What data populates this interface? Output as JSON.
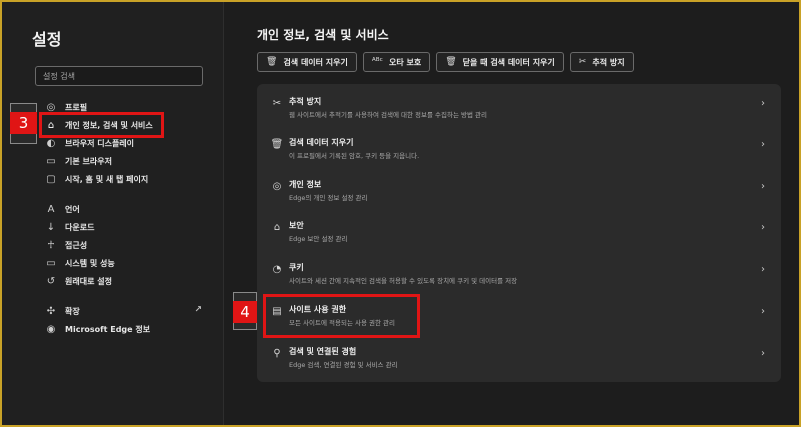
{
  "sidebar": {
    "title": "설정",
    "search_placeholder": "설정 검색",
    "items": [
      {
        "label": "프로필",
        "icon": "profile-icon"
      },
      {
        "label": "개인 정보, 검색 및 서비스",
        "icon": "lock-icon"
      },
      {
        "label": "브라우저 디스플레이",
        "icon": "palette-icon"
      },
      {
        "label": "기본 브라우저",
        "icon": "browser-icon"
      },
      {
        "label": "시작, 홈 및 새 탭 페이지",
        "icon": "home-icon"
      },
      {
        "label": "언어",
        "icon": "language-icon"
      },
      {
        "label": "다운로드",
        "icon": "download-icon"
      },
      {
        "label": "접근성",
        "icon": "accessibility-icon"
      },
      {
        "label": "시스템 및 성능",
        "icon": "system-icon"
      },
      {
        "label": "원래대로 설정",
        "icon": "reset-icon"
      },
      {
        "label": "확장",
        "icon": "extension-icon"
      },
      {
        "label": "Microsoft Edge 정보",
        "icon": "edge-icon"
      }
    ]
  },
  "main": {
    "title": "개인 정보, 검색 및 서비스",
    "quick_buttons": [
      {
        "label": "검색 데이터 지우기",
        "icon": "trash-icon"
      },
      {
        "label": "오타 보호",
        "icon": "spellcheck-icon"
      },
      {
        "label": "닫을 때 검색 데이터 지우기",
        "icon": "trash-clock-icon"
      },
      {
        "label": "추적 방지",
        "icon": "tracking-icon"
      }
    ],
    "rows": [
      {
        "title": "추적 방지",
        "subtitle": "웹 사이트에서 추적기를 사용하여 검색에 대한 정보를 수집하는 방법 관리",
        "icon": "tracking-icon"
      },
      {
        "title": "검색 데이터 지우기",
        "subtitle": "이 프로필에서 기록된 암호, 쿠키 등을 지웁니다.",
        "icon": "trash-icon"
      },
      {
        "title": "개인 정보",
        "subtitle": "Edge의 개인 정보 설정 관리",
        "icon": "privacy-icon"
      },
      {
        "title": "보안",
        "subtitle": "Edge 보안 설정 관리",
        "icon": "lock-icon"
      },
      {
        "title": "쿠키",
        "subtitle": "사이트와 세션 간에 지속적인 검색을 허용할 수 있도록 장치에 쿠키 및 데이터를 저장",
        "icon": "cookie-icon"
      },
      {
        "title": "사이트 사용 권한",
        "subtitle": "모든 사이트에 적용되는 사용 권한 관리",
        "icon": "site-permissions-icon"
      },
      {
        "title": "검색 및 연결된 경험",
        "subtitle": "Edge 검색, 연결된 경험 및 서비스 관리",
        "icon": "search-icon"
      }
    ]
  },
  "annotations": {
    "step3": "3",
    "step4": "4",
    "color": "#e01515"
  }
}
